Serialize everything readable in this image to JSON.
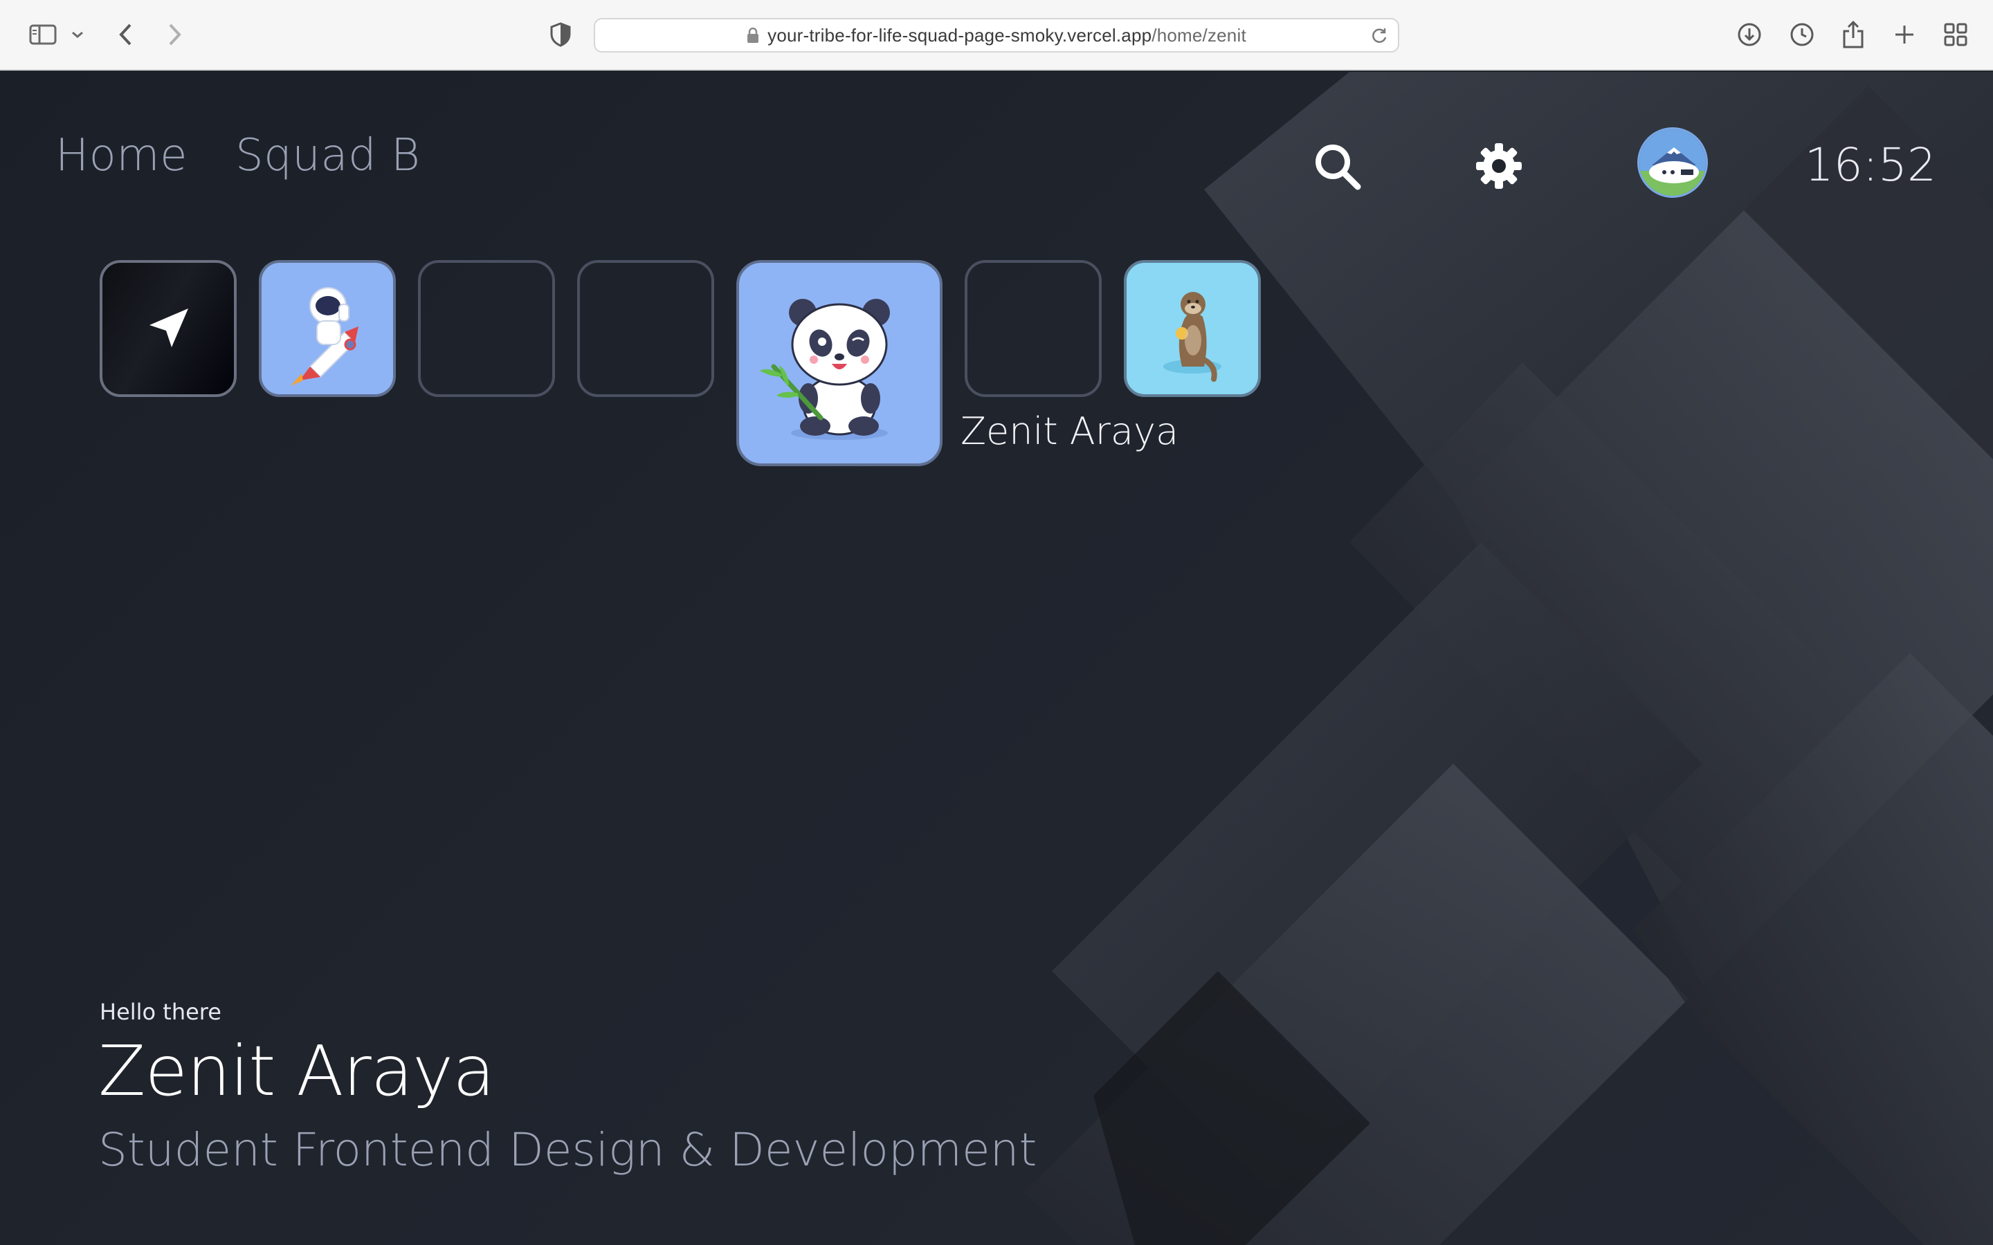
{
  "browser": {
    "url_prefix": "your-tribe-for-life-squad-page-smoky.vercel.app",
    "url_path": "/home/zenit",
    "icons": [
      "sidebar-icon",
      "chevron-down-icon",
      "back-icon",
      "forward-icon",
      "shield-icon",
      "lock-icon",
      "reload-icon",
      "download-icon",
      "history-icon",
      "share-icon",
      "new-tab-icon",
      "tab-overview-icon"
    ]
  },
  "nav": {
    "home_label": "Home",
    "squad_label": "Squad B"
  },
  "header": {
    "icons": [
      "search-icon",
      "gear-icon"
    ],
    "time": "16:52"
  },
  "tiles": {
    "selected_caption": "Zenit Araya",
    "items": [
      {
        "kind": "navigation-arrow-icon"
      },
      {
        "kind": "astronaut-avatar"
      },
      {
        "kind": "empty"
      },
      {
        "kind": "empty"
      },
      {
        "kind": "panda-avatar",
        "selected": true
      },
      {
        "kind": "empty"
      },
      {
        "kind": "otter-avatar"
      }
    ]
  },
  "hero": {
    "greeting": "Hello there",
    "name": "Zenit Araya",
    "role": "Student Frontend Design & Development"
  },
  "colors": {
    "page_bg": "#1f232c",
    "tile_blue": "#8fb4f5",
    "tile_cyan": "#8ad8f3",
    "muted_text": "#9aa1b4"
  }
}
